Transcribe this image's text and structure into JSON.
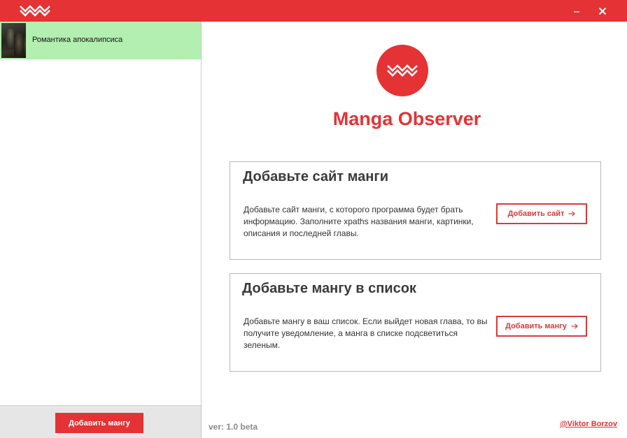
{
  "titlebar": {
    "logo_icon": "zigzag-logo-icon",
    "minimize_label": "–",
    "close_label": "✕",
    "color": "#e53234"
  },
  "sidebar": {
    "items": [
      {
        "title": "Романтика апокалипсиса",
        "status": "new-chapter",
        "highlight_color": "#b2efb0"
      }
    ],
    "add_button_label": "Добавить мангу"
  },
  "main": {
    "logo_icon": "zigzag-logo-icon",
    "app_title": "Manga Observer",
    "cards": [
      {
        "heading": "Добавьте сайт манги",
        "text": "Добавьте сайт манги, с которого программа будет брать информацию. Заполните xpaths названия манги, картинки, описания и последней главы.",
        "button_label": "Добавить сайт",
        "button_icon": "arrow-right-icon"
      },
      {
        "heading": "Добавьте мангу в список",
        "text": "Добавьте мангу в ваш список. Если выйдет новая глава, то вы получите уведомление, а манга в списке подсветиться зеленым.",
        "button_label": "Добавить мангу",
        "button_icon": "arrow-right-icon"
      }
    ],
    "version": "ver: 1.0 beta",
    "author": "@Viktor Borzov"
  },
  "colors": {
    "accent": "#e53234",
    "highlight": "#b2efb0"
  }
}
